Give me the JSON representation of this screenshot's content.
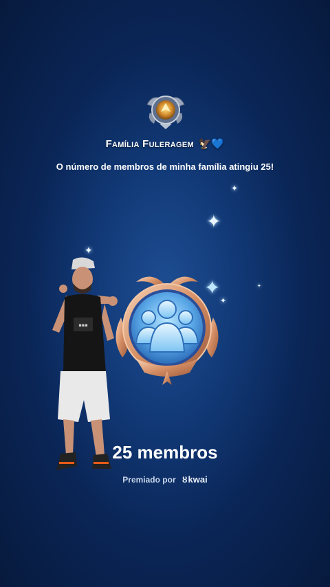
{
  "family": {
    "name": "Família Fuleragem",
    "emojis": "🦅💙",
    "emblem_icon": "eagle-shield-emblem-icon"
  },
  "milestone": {
    "message": "O número de membros de minha família atingiu 25!",
    "badge_icon": "family-members-badge-icon",
    "count_label": "25 membros"
  },
  "award": {
    "prefix": "Premiado por",
    "brand": "kwai",
    "brand_icon": "kwai-logo-icon"
  },
  "colors": {
    "background": "#0d2d63",
    "badge_gold": "#e7b08a",
    "badge_blue": "#6bbcf0"
  }
}
